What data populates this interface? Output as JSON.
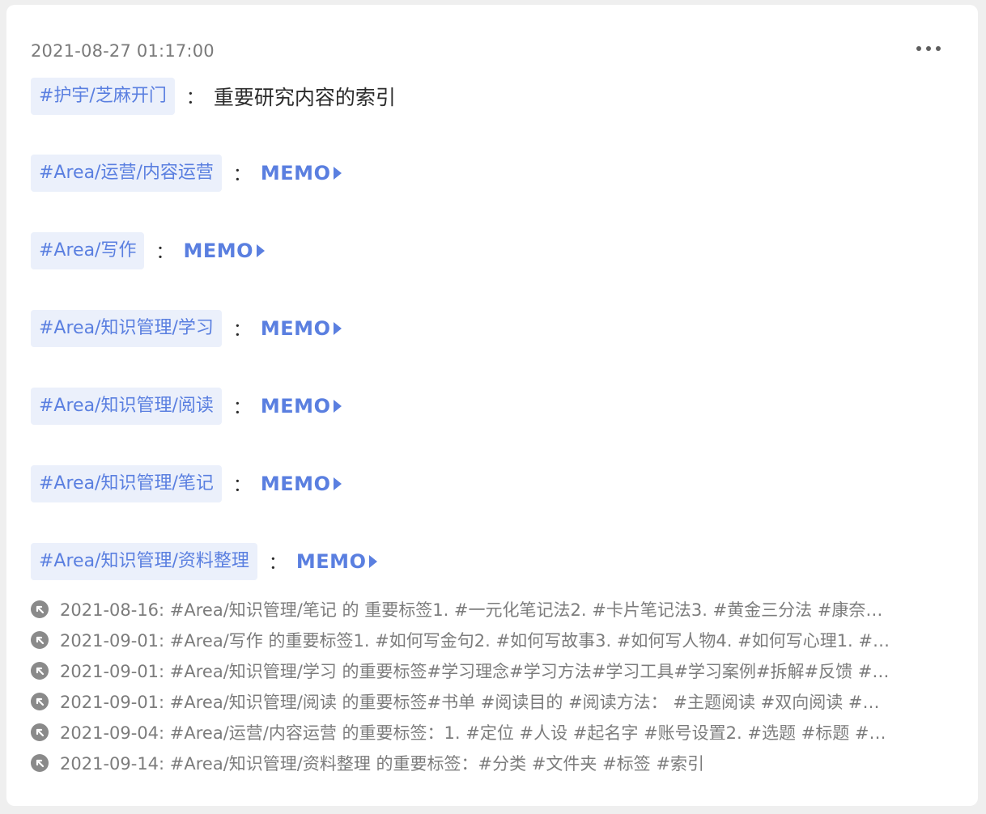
{
  "memo": {
    "timestamp": "2021-08-27 01:17:00",
    "more_icon": "more-horizontal-icon",
    "colon": "：",
    "memo_link_label": "MEMO",
    "memo_link_icon": "triangle-right-icon",
    "header_tag": "#护宇/芝麻开门",
    "header_desc": "重要研究内容的索引",
    "entries": [
      {
        "tag": "#Area/运营/内容运营"
      },
      {
        "tag": "#Area/写作"
      },
      {
        "tag": "#Area/知识管理/学习"
      },
      {
        "tag": "#Area/知识管理/阅读"
      },
      {
        "tag": "#Area/知识管理/笔记"
      },
      {
        "tag": "#Area/知识管理/资料整理"
      }
    ],
    "references": [
      "2021-08-16: #Area/知识管理/笔记 的 重要标签1. #一元化笔记法2. #卡片笔记法3. #黄金三分法 #康奈…",
      "2021-09-01: #Area/写作 的重要标签1. #如何写金句2. #如何写故事3. #如何写人物4. #如何写心理1. #…",
      "2021-09-01: #Area/知识管理/学习 的重要标签#学习理念#学习方法#学习工具#学习案例#拆解#反馈 #…",
      "2021-09-01: #Area/知识管理/阅读 的重要标签#书单 #阅读目的 #阅读方法： #主题阅读 #双向阅读 #…",
      "2021-09-04: #Area/运营/内容运营 的重要标签：1. #定位 #人设 #起名字  #账号设置2. #选题 #标题 #…",
      "2021-09-14: #Area/知识管理/资料整理 的重要标签：#分类 #文件夹 #标签 #索引"
    ],
    "reference_icon": "arrow-up-left-circle-icon",
    "colors": {
      "accent": "#5a7fe0",
      "tag_bg": "#ebf0fb",
      "muted": "#7c7c7c"
    }
  }
}
